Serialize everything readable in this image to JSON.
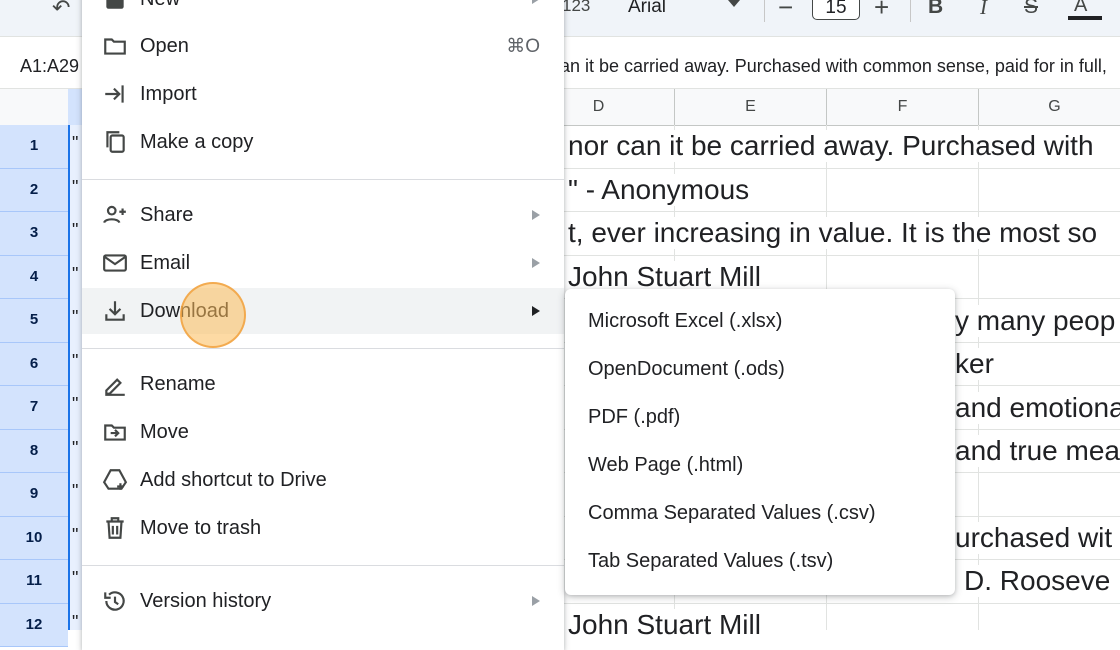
{
  "toolbar": {
    "undo_icon": "undo-icon",
    "number_format": "123",
    "font": "Arial",
    "font_size": "15",
    "minus": "−",
    "plus": "+",
    "bold": "B",
    "italic": "I",
    "strike": "S",
    "text_color": "A"
  },
  "formula_bar": {
    "name_box": "A1:A29",
    "formula": "an it be carried away. Purchased with common sense, paid for in full,"
  },
  "grid": {
    "columns": [
      "D",
      "E",
      "F",
      "G"
    ],
    "rows": [
      "1",
      "2",
      "3",
      "4",
      "5",
      "6",
      "7",
      "8",
      "9",
      "10",
      "11",
      "12"
    ],
    "cells": [
      " nor can it be carried away. Purchased with",
      "\" - Anonymous",
      "t, ever increasing in value. It is the most so",
      "John Stuart Mill",
      "",
      "",
      "",
      "",
      "",
      "",
      "",
      "John Stuart Mill"
    ],
    "overflow_cells": [
      {
        "row": 5,
        "text": "y many peop"
      },
      {
        "row": 6,
        "text": "ker"
      },
      {
        "row": 7,
        "text": "and emotiona"
      },
      {
        "row": 8,
        "text": "and true mea"
      },
      {
        "row": 10,
        "text": "urchased wit"
      },
      {
        "row": 11,
        "text": "D. Rooseve"
      }
    ]
  },
  "file_menu": {
    "items": [
      {
        "label": "New",
        "icon": "new-icon",
        "arrow": true
      },
      {
        "label": "Open",
        "icon": "folder-icon",
        "shortcut": "⌘O"
      },
      {
        "label": "Import",
        "icon": "import-icon"
      },
      {
        "label": "Make a copy",
        "icon": "copy-icon"
      },
      {
        "label": "Share",
        "icon": "share-person-icon",
        "arrow": true
      },
      {
        "label": "Email",
        "icon": "email-icon",
        "arrow": true
      },
      {
        "label": "Download",
        "icon": "download-icon",
        "arrow": true,
        "highlighted": true
      },
      {
        "label": "Rename",
        "icon": "rename-icon"
      },
      {
        "label": "Move",
        "icon": "move-folder-icon"
      },
      {
        "label": "Add shortcut to Drive",
        "icon": "drive-shortcut-icon"
      },
      {
        "label": "Move to trash",
        "icon": "trash-icon"
      },
      {
        "label": "Version history",
        "icon": "history-icon",
        "arrow": true
      }
    ]
  },
  "download_submenu": {
    "items": [
      "Microsoft Excel (.xlsx)",
      "OpenDocument (.ods)",
      "PDF (.pdf)",
      "Web Page (.html)",
      "Comma Separated Values (.csv)",
      "Tab Separated Values (.tsv)"
    ]
  },
  "colors": {
    "accent": "#1a73e8",
    "selection": "#d3e3fd",
    "menu_highlight": "#f1f3f4",
    "click_marker": "#fbbc5a"
  }
}
